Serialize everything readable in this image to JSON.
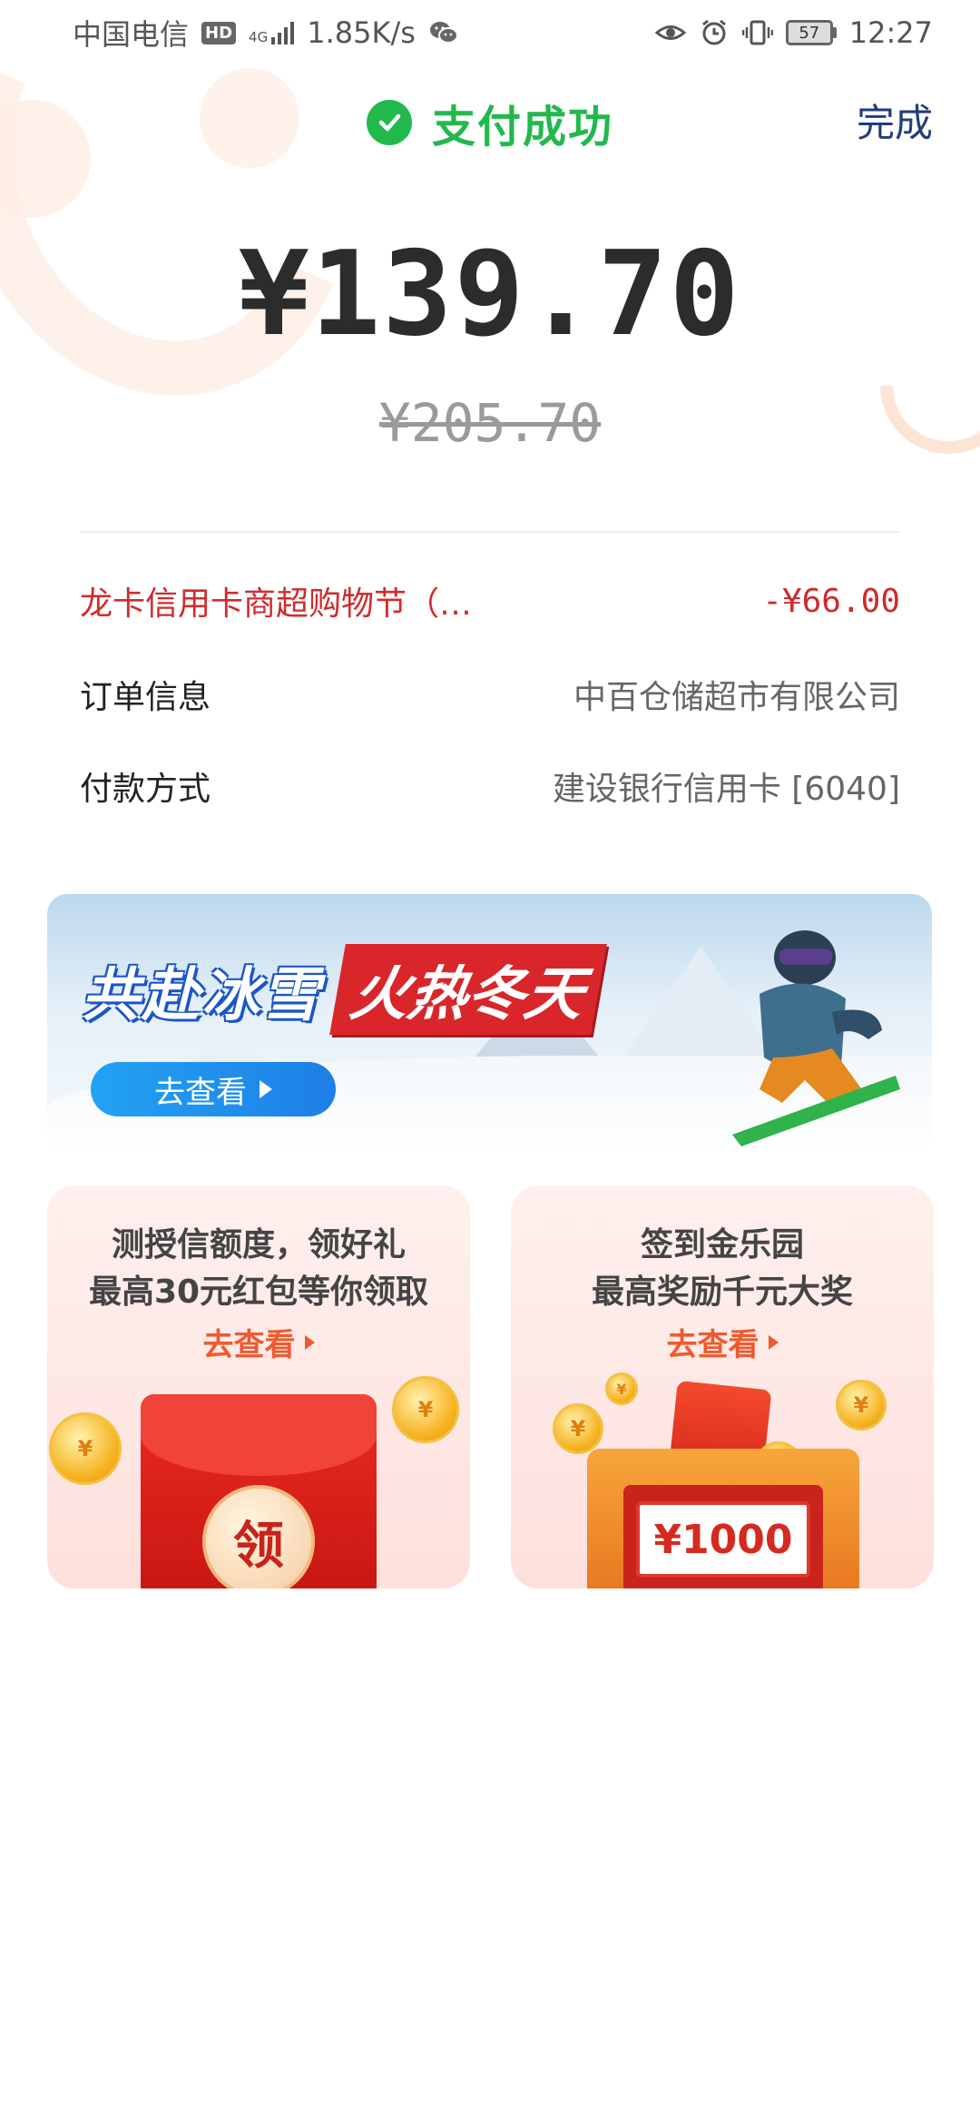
{
  "status_bar": {
    "carrier": "中国电信",
    "hd": "HD",
    "network": "4G",
    "speed": "1.85K/s",
    "battery": "57",
    "time": "12:27"
  },
  "header": {
    "title": "支付成功",
    "done_label": "完成",
    "accent_color": "#22b94c"
  },
  "payment": {
    "amount": "¥139.70",
    "original_amount": "¥205.70"
  },
  "details": {
    "discount": {
      "label": "龙卡信用卡商超购物节（…",
      "value": "-¥66.00"
    },
    "order": {
      "label": "订单信息",
      "value": "中百仓储超市有限公司"
    },
    "payment_method": {
      "label": "付款方式",
      "value": "建设银行信用卡 [6040]"
    }
  },
  "banner": {
    "title_part1": "共赴冰雪",
    "title_part2": "火热冬天",
    "button_label": "去查看"
  },
  "cards": [
    {
      "line1": "测授信额度，领好礼",
      "line2": "最高30元红包等你领取",
      "link": "去查看",
      "seal_text": "领"
    },
    {
      "line1": "签到金乐园",
      "line2": "最高奖励千元大奖",
      "link": "去查看",
      "prize": "¥1000"
    }
  ]
}
